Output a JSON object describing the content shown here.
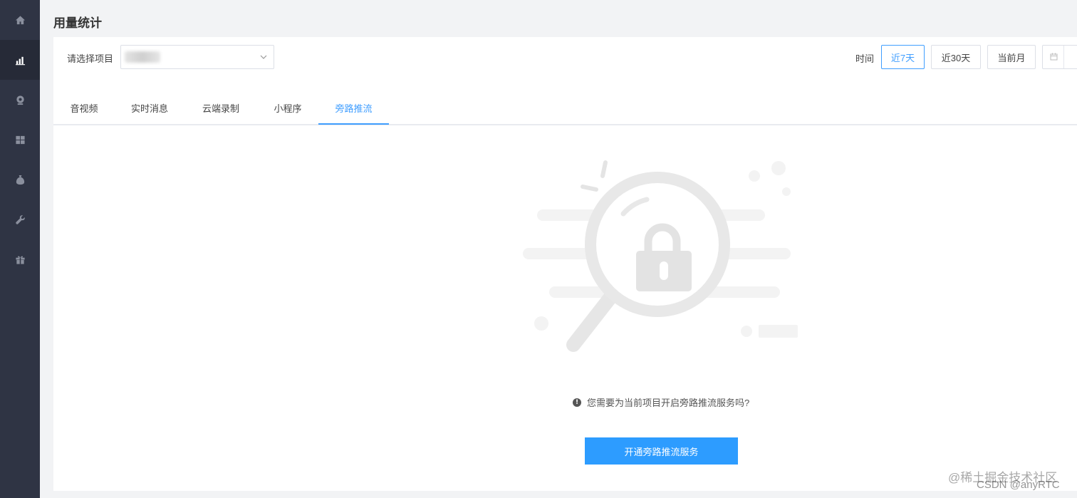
{
  "page_title": "用量统计",
  "project": {
    "label": "请选择项目",
    "value": ""
  },
  "time": {
    "label": "时间",
    "options": [
      "近7天",
      "近30天",
      "当前月"
    ],
    "active": "近7天"
  },
  "tabs": [
    "音视频",
    "实时消息",
    "云端录制",
    "小程序",
    "旁路推流"
  ],
  "active_tab": "旁路推流",
  "empty_state": {
    "message": "您需要为当前项目开启旁路推流服务吗?",
    "info_glyph": "!",
    "button_label": "开通旁路推流服务"
  },
  "sidebar": {
    "icons": [
      "home-icon",
      "bar-chart-icon",
      "webcam-icon",
      "grid-icon",
      "money-bag-icon",
      "wrench-icon",
      "gift-icon"
    ],
    "active_index": 1
  },
  "colors": {
    "accent": "#409eff",
    "primary_button": "#2d9cff",
    "sidebar": "#2f3444"
  },
  "watermark": {
    "line1": "@稀土掘金技术社区",
    "line2": "CSDN @anyRTC"
  }
}
